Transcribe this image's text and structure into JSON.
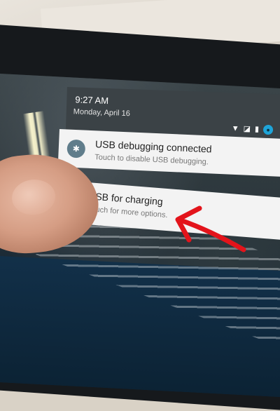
{
  "status_bar": {
    "time": "9:27 AM",
    "date": "Monday, April 16",
    "icons": [
      "wifi-icon",
      "no-sim-icon",
      "battery-icon",
      "account-icon"
    ]
  },
  "notifications": [
    {
      "icon": "android-debug-icon",
      "title": "USB debugging connected",
      "subtitle": "Touch to disable USB debugging."
    },
    {
      "icon": "usb-icon",
      "title": "USB for charging",
      "subtitle": "Touch for more options."
    }
  ],
  "colors": {
    "shade_header": "#3b4246",
    "notification_card": "#f3f3f3",
    "annotation_arrow": "#e3141b",
    "account_badge": "#1ea4d8"
  }
}
